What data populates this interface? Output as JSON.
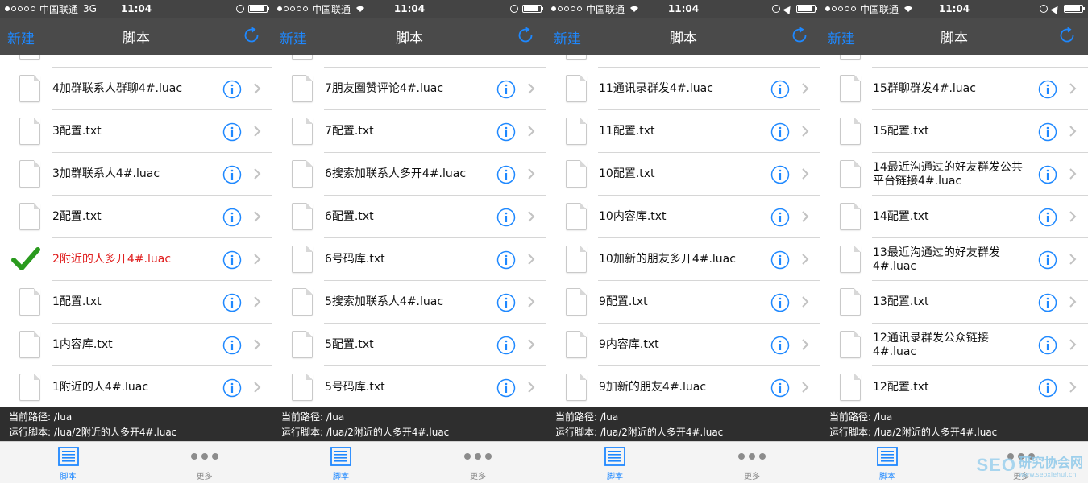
{
  "status_bar": {
    "carrier": "中国联通",
    "network": "3G",
    "time": "11:04"
  },
  "nav": {
    "new_label": "新建",
    "title": "脚本"
  },
  "info": {
    "current_path": "当前路径: /lua",
    "running_script": "运行脚本: /lua/2附近的人多开4#.luac"
  },
  "tabs": {
    "script_label": "脚本",
    "more_label": "更多"
  },
  "watermark": {
    "seo": "SEO",
    "name": "研究协会网",
    "url": "www.seoxiehui.cn"
  },
  "screens": [
    {
      "network": "3G",
      "rows": [
        {
          "label": "4加群联系人群聊4#.luac",
          "active": false
        },
        {
          "label": "3配置.txt",
          "active": false
        },
        {
          "label": "3加群联系人4#.luac",
          "active": false
        },
        {
          "label": "2配置.txt",
          "active": false
        },
        {
          "label": "2附近的人多开4#.luac",
          "active": true
        },
        {
          "label": "1配置.txt",
          "active": false
        },
        {
          "label": "1内容库.txt",
          "active": false
        },
        {
          "label": "1附近的人4#.luac",
          "active": false
        }
      ]
    },
    {
      "network": "wifi",
      "rows": [
        {
          "label": "7朋友圈赞评论4#.luac",
          "active": false
        },
        {
          "label": "7配置.txt",
          "active": false
        },
        {
          "label": "6搜索加联系人多开4#.luac",
          "active": false
        },
        {
          "label": "6配置.txt",
          "active": false
        },
        {
          "label": "6号码库.txt",
          "active": false
        },
        {
          "label": "5搜索加联系人4#.luac",
          "active": false
        },
        {
          "label": "5配置.txt",
          "active": false
        },
        {
          "label": "5号码库.txt",
          "active": false
        }
      ]
    },
    {
      "network": "wifi",
      "rows": [
        {
          "label": "11通讯录群发4#.luac",
          "active": false
        },
        {
          "label": "11配置.txt",
          "active": false
        },
        {
          "label": "10配置.txt",
          "active": false
        },
        {
          "label": "10内容库.txt",
          "active": false
        },
        {
          "label": "10加新的朋友多开4#.luac",
          "active": false
        },
        {
          "label": "9配置.txt",
          "active": false
        },
        {
          "label": "9内容库.txt",
          "active": false
        },
        {
          "label": "9加新的朋友4#.luac",
          "active": false
        }
      ]
    },
    {
      "network": "wifi",
      "rows": [
        {
          "label": "15群聊群发4#.luac",
          "active": false
        },
        {
          "label": "15配置.txt",
          "active": false
        },
        {
          "label": "14最近沟通过的好友群发公共平台链接4#.luac",
          "active": false
        },
        {
          "label": "14配置.txt",
          "active": false
        },
        {
          "label": "13最近沟通过的好友群发4#.luac",
          "active": false
        },
        {
          "label": "13配置.txt",
          "active": false
        },
        {
          "label": "12通讯录群发公众链接4#.luac",
          "active": false
        },
        {
          "label": "12配置.txt",
          "active": false
        }
      ]
    }
  ],
  "colors": {
    "accent": "#1e88ff",
    "active_text": "#e02020",
    "check": "#2a9a1e"
  }
}
